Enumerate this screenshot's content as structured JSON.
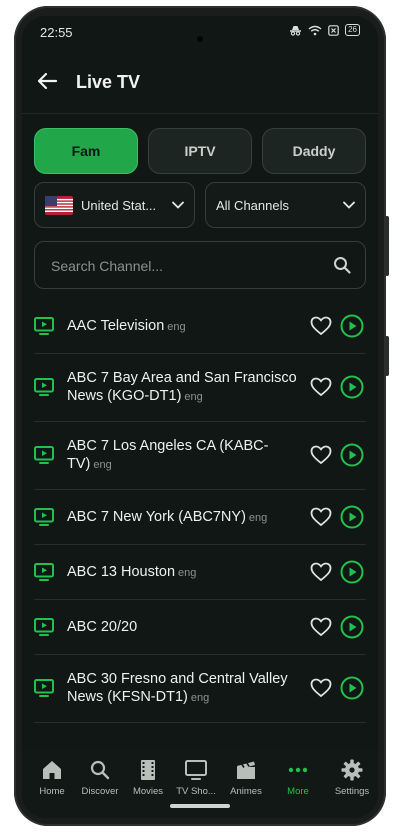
{
  "status_bar": {
    "time": "22:55",
    "battery": "26"
  },
  "app_bar": {
    "title": "Live TV"
  },
  "tabs": [
    {
      "label": "Fam",
      "active": true
    },
    {
      "label": "IPTV",
      "active": false
    },
    {
      "label": "Daddy",
      "active": false
    }
  ],
  "filters": {
    "country": "United Stat...",
    "category": "All Channels"
  },
  "search": {
    "placeholder": "Search Channel..."
  },
  "channels": [
    {
      "name": "AAC Television",
      "lang": "eng",
      "lines": 1
    },
    {
      "name": "ABC 7 Bay Area and San Francisco News (KGO-DT1)",
      "lang": "eng",
      "lines": 2
    },
    {
      "name": "ABC 7 Los Angeles CA (KABC-TV)",
      "lang": "eng",
      "lines": 2
    },
    {
      "name": "ABC 7 New York (ABC7NY)",
      "lang": "eng",
      "lines": 1
    },
    {
      "name": "ABC 13 Houston",
      "lang": "eng",
      "lines": 1
    },
    {
      "name": "ABC 20/20",
      "lang": "",
      "lines": 1
    },
    {
      "name": "ABC 30 Fresno and Central Valley News (KFSN-DT1)",
      "lang": "eng",
      "lines": 2
    }
  ],
  "nav": [
    {
      "label": "Home",
      "icon": "home-icon"
    },
    {
      "label": "Discover",
      "icon": "search-icon"
    },
    {
      "label": "Movies",
      "icon": "film-icon"
    },
    {
      "label": "TV Sho...",
      "icon": "tv-icon"
    },
    {
      "label": "Animes",
      "icon": "clapper-icon"
    },
    {
      "label": "More",
      "icon": "more-dots-icon",
      "active": true
    },
    {
      "label": "Settings",
      "icon": "gear-icon"
    }
  ],
  "colors": {
    "accent": "#22c14e",
    "background": "#101714"
  }
}
